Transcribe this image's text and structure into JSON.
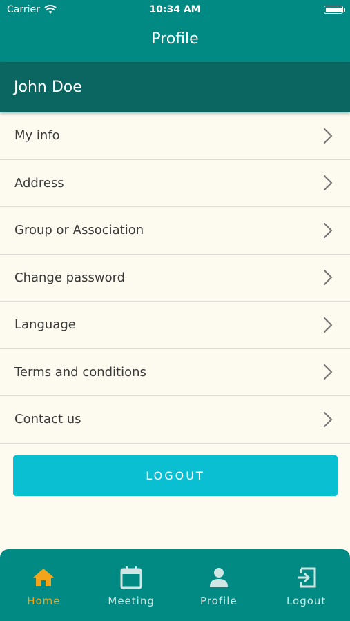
{
  "status_bar": {
    "carrier": "Carrier",
    "time": "10:34 AM"
  },
  "header": {
    "title": "Profile"
  },
  "user": {
    "name": "John Doe"
  },
  "menu": {
    "items": [
      {
        "label": "My info"
      },
      {
        "label": "Address"
      },
      {
        "label": "Group or Association"
      },
      {
        "label": "Change password"
      },
      {
        "label": "Language"
      },
      {
        "label": "Terms and conditions"
      },
      {
        "label": "Contact us"
      }
    ]
  },
  "logout_button": {
    "label": "LOGOUT"
  },
  "tabs": [
    {
      "label": "Home",
      "icon": "home-icon",
      "active": true
    },
    {
      "label": "Meeting",
      "icon": "calendar-icon",
      "active": false
    },
    {
      "label": "Profile",
      "icon": "person-icon",
      "active": false
    },
    {
      "label": "Logout",
      "icon": "logout-icon",
      "active": false
    }
  ],
  "colors": {
    "header": "#008a83",
    "user_bar": "#0b6561",
    "background": "#fdfaf0",
    "button": "#0bbfd2",
    "active_tab": "#f2a51a"
  }
}
